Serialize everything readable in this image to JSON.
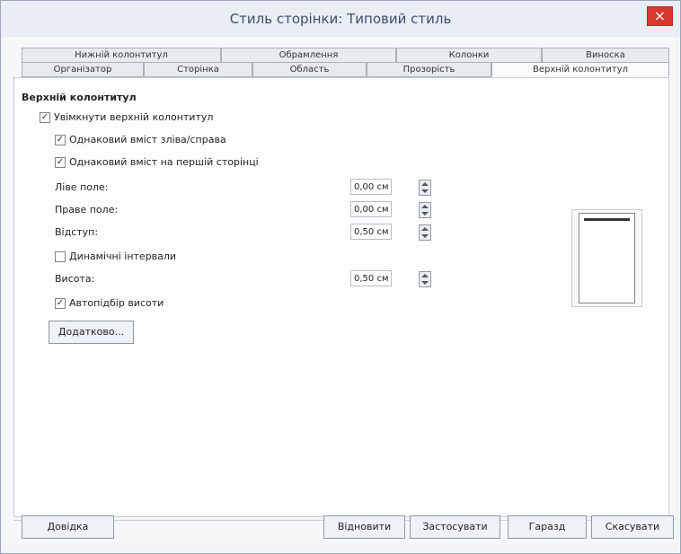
{
  "window": {
    "title": "Стиль сторінки: Типовий стиль"
  },
  "tabs": {
    "row1": [
      "Нижній колонтитул",
      "Обрамлення",
      "Колонки",
      "Виноска"
    ],
    "row2": [
      "Організатор",
      "Сторінка",
      "Область",
      "Прозорість",
      "Верхній колонтитул"
    ]
  },
  "header": {
    "title": "Верхній колонтитул",
    "enable": "Увімкнути верхній колонтитул",
    "same_lr": "Однаковий вміст зліва/справа",
    "same_first": "Однаковий вміст на першій сторінці",
    "left_margin": "Ліве поле:",
    "left_value": "0,00 см",
    "right_margin": "Праве поле:",
    "right_value": "0,00 см",
    "spacing": "Відступ:",
    "spacing_value": "0,50 см",
    "dynamic": "Динамічні інтервали",
    "height": "Висота:",
    "height_value": "0,50 см",
    "autofit": "Автопідбір висоти",
    "more": "Додатково..."
  },
  "buttons": {
    "help": "Довідка",
    "reset": "Відновити",
    "apply": "Застосувати",
    "ok": "Гаразд",
    "cancel": "Скасувати"
  }
}
